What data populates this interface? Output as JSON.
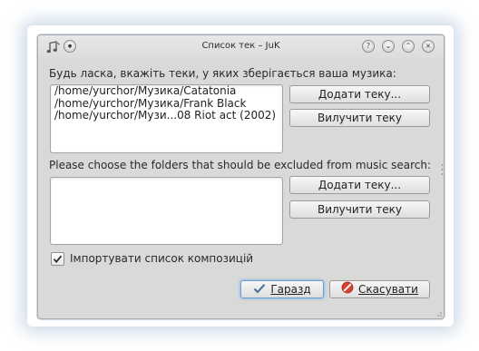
{
  "window": {
    "title": "Список тек – JuK",
    "app_icon": "music-note-icon",
    "controls": {
      "help": "?",
      "minimize": "⌄",
      "maximize": "⌃",
      "close": "×"
    }
  },
  "folders_section": {
    "label": "Будь ласка, вкажіть теки, у яких зберігається ваша музика:",
    "items": [
      "/home/yurchor/Музика/Catatonia",
      "/home/yurchor/Музика/Frank Black",
      "/home/yurchor/Музи...08 Riot act (2002)"
    ],
    "add_button": "Додати теку...",
    "remove_button": "Вилучити теку"
  },
  "exclude_section": {
    "label": "Please choose the folders that should be excluded from music search:",
    "items": [],
    "add_button": "Додати теку...",
    "remove_button": "Вилучити теку"
  },
  "import_checkbox": {
    "label": "Імпортувати список композицій",
    "checked": true
  },
  "footer": {
    "ok_label": "Гаразд",
    "ok_icon": "checkmark-icon",
    "cancel_label": "Скасувати",
    "cancel_icon": "cancel-icon"
  }
}
